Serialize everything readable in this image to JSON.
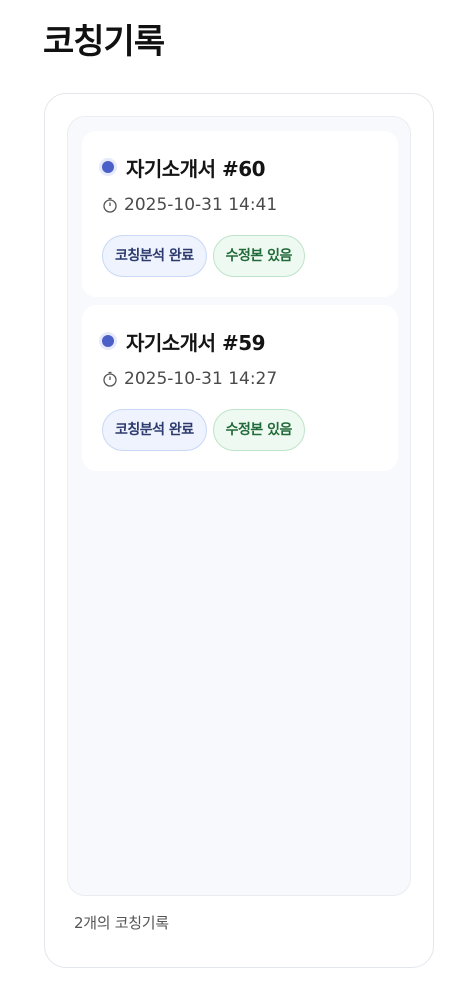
{
  "page": {
    "title": "코칭기록"
  },
  "records": [
    {
      "title": "자기소개서 #60",
      "time": "2025-10-31 14:41",
      "tags": {
        "analysis": "코칭분석 완료",
        "revised": "수정본 있음"
      }
    },
    {
      "title": "자기소개서 #59",
      "time": "2025-10-31 14:27",
      "tags": {
        "analysis": "코칭분석 완료",
        "revised": "수정본 있음"
      }
    }
  ],
  "footer": {
    "count_text": "2개의 코칭기록"
  },
  "icons": {
    "status_dot": "dot-icon",
    "time": "stopwatch-icon"
  },
  "colors": {
    "accent_dot": "#4a5fc7",
    "analysis_tag_bg": "#eef3fd",
    "revised_tag_bg": "#eefaf1"
  }
}
